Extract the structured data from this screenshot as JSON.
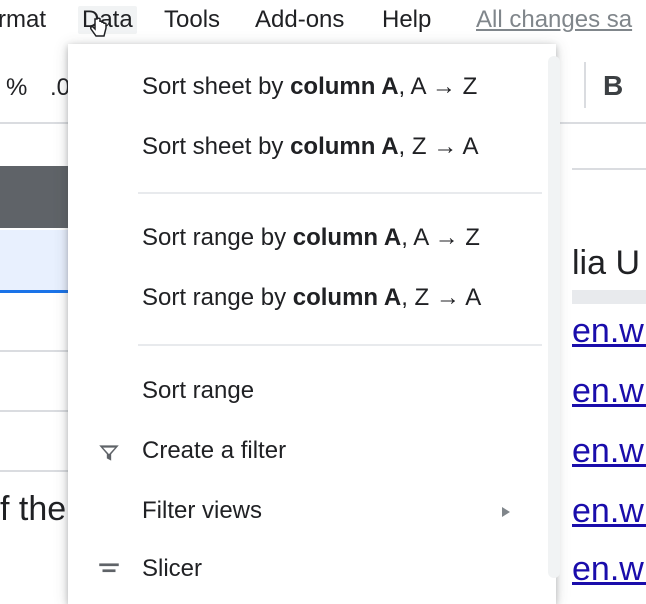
{
  "menubar": {
    "items": [
      "rmat",
      "Data",
      "Tools",
      "Add-ons",
      "Help"
    ],
    "saved_text": "All changes sa"
  },
  "toolbar": {
    "percent": "%",
    "decimal": ".0",
    "bold": "B"
  },
  "sheet": {
    "left_text": "f the",
    "right_text": "lia U",
    "right_links": [
      "en.wi",
      "en.wi",
      "en.wi",
      "en.wi",
      "en.wi"
    ]
  },
  "dropdown": {
    "sort_sheet_az": {
      "prefix": "Sort sheet by ",
      "col": "column A",
      "suffix": ", A → Z"
    },
    "sort_sheet_za": {
      "prefix": "Sort sheet by ",
      "col": "column A",
      "suffix": ", Z → A"
    },
    "sort_range_az": {
      "prefix": "Sort range by ",
      "col": "column A",
      "suffix": ", A → Z"
    },
    "sort_range_za": {
      "prefix": "Sort range by ",
      "col": "column A",
      "suffix": ", Z → A"
    },
    "sort_range": "Sort range",
    "create_filter": "Create a filter",
    "filter_views": "Filter views",
    "slicer": "Slicer",
    "icons": [
      "filter-icon",
      "slicer-icon",
      "submenu-arrow-icon"
    ]
  }
}
